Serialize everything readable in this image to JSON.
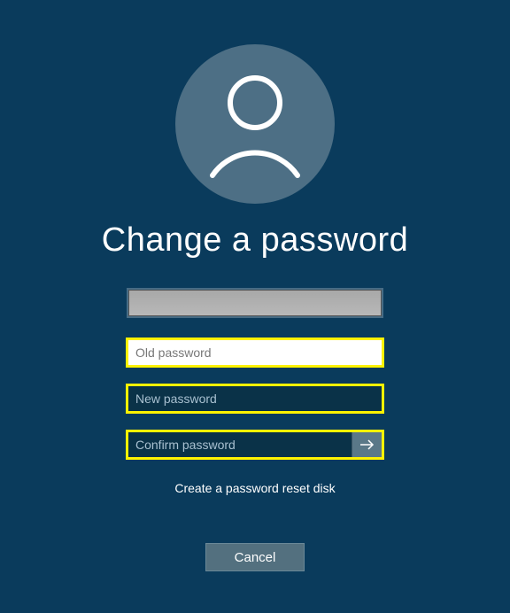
{
  "title": "Change a password",
  "fields": {
    "username": {
      "value": ""
    },
    "old_password": {
      "placeholder": "Old password",
      "value": ""
    },
    "new_password": {
      "placeholder": "New password",
      "value": ""
    },
    "confirm_password": {
      "placeholder": "Confirm password",
      "value": ""
    }
  },
  "links": {
    "reset_disk": "Create a password reset disk"
  },
  "buttons": {
    "cancel": "Cancel"
  },
  "icons": {
    "user": "user-icon",
    "submit": "arrow-right-icon"
  }
}
